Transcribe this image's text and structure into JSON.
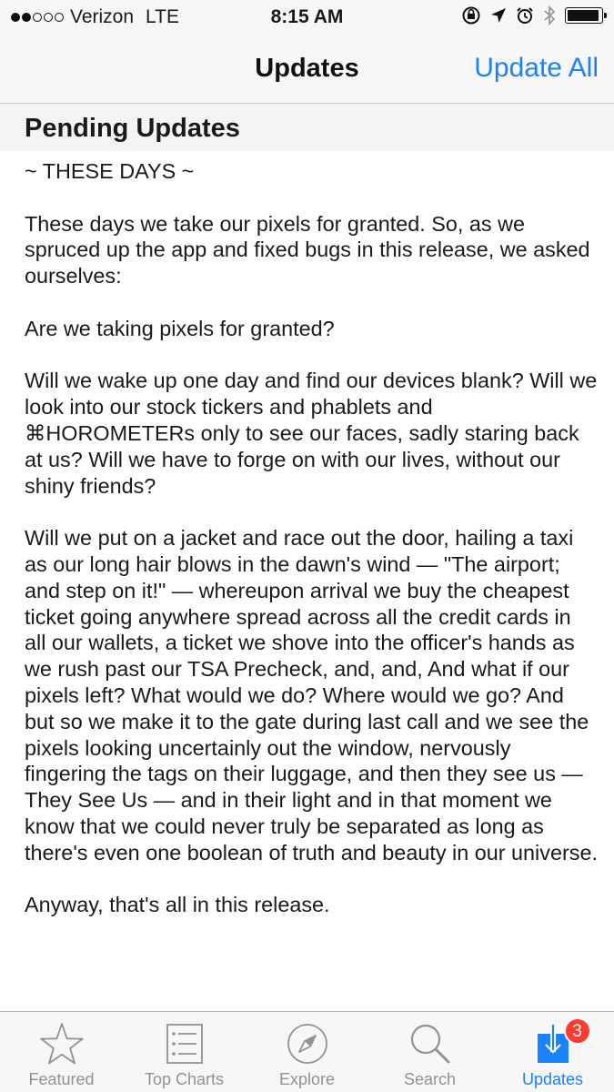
{
  "status_bar": {
    "carrier": "Verizon",
    "network": "LTE",
    "time": "8:15 AM",
    "signal_bars_filled": 2,
    "signal_bars_total": 5,
    "battery_level": 0.95,
    "icons": [
      "orientation-lock-icon",
      "location-arrow-icon",
      "alarm-icon",
      "bluetooth-icon",
      "battery-icon"
    ]
  },
  "nav": {
    "title": "Updates",
    "right_button": "Update All"
  },
  "section": {
    "title": "Pending Updates"
  },
  "release_notes": [
    "~ THESE DAYS ~",
    "These days we take our pixels for granted. So, as we spruced up the app and fixed bugs in this release, we asked ourselves:",
    "Are we taking pixels for granted?",
    "Will we wake up one day and find our devices blank? Will we look into our stock tickers and phablets and ⌘HOROMETERs only to see our faces, sadly staring back at us? Will we have to forge on with our lives, without our shiny friends?",
    "Will we put on a jacket and race out the door, hailing a taxi as our long hair blows in the dawn's wind — \"The airport; and step on it!\" — whereupon arrival we buy the cheapest ticket going anywhere spread across all the credit cards in all our wallets, a ticket we shove into the officer's hands as we rush past our TSA Precheck, and, and, And what if our pixels left? What would we do? Where would we go? And but so we make it to the gate during last call and we see the pixels looking uncertainly out the window, nervously fingering the tags on their luggage, and then they see us — They See Us — and in their light and in that moment we know that we could never truly be separated as long as there's even one boolean of truth and beauty in our universe.",
    "Anyway, that's all in this release."
  ],
  "tabs": [
    {
      "label": "Featured",
      "icon": "star-icon",
      "active": false
    },
    {
      "label": "Top Charts",
      "icon": "list-icon",
      "active": false
    },
    {
      "label": "Explore",
      "icon": "compass-icon",
      "active": false
    },
    {
      "label": "Search",
      "icon": "search-icon",
      "active": false
    },
    {
      "label": "Updates",
      "icon": "updates-icon",
      "active": true,
      "badge": "3"
    }
  ],
  "colors": {
    "accent": "#1a82fb",
    "badge": "#ff3b30",
    "inactive_tab": "#929292"
  }
}
